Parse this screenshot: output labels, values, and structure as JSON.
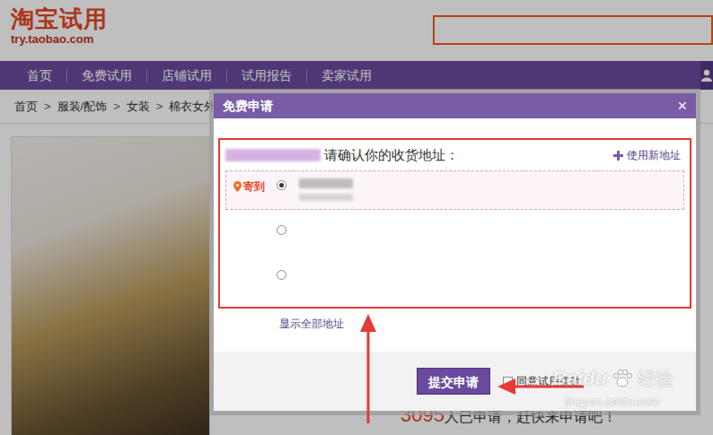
{
  "header": {
    "logo": "淘宝试用",
    "domain": "try.taobao.com"
  },
  "nav": [
    {
      "label": "首页"
    },
    {
      "label": "免费试用"
    },
    {
      "label": "店铺试用"
    },
    {
      "label": "试用报告"
    },
    {
      "label": "卖家试用"
    }
  ],
  "breadcrumb": {
    "items": [
      "首页",
      "服装/配饰",
      "女装",
      "棉衣女外"
    ],
    "separator": ">"
  },
  "applicants": {
    "count": "3095",
    "text": "人已申请，赶快来申请吧！"
  },
  "dialog": {
    "title": "免费申请",
    "close": "×",
    "prompt": "请确认你的收货地址：",
    "new_address": "使用新地址",
    "addresses": [
      {
        "selected": true,
        "tag": "寄到"
      },
      {
        "selected": false,
        "tag": ""
      },
      {
        "selected": false,
        "tag": ""
      }
    ],
    "show_all": "显示全部地址",
    "submit": "提交申请",
    "agree": {
      "label": "同意试用条款",
      "checked": false
    }
  },
  "watermark": {
    "brand": "Baidu",
    "product": "经验",
    "url": "jingyan.baidu.com"
  }
}
